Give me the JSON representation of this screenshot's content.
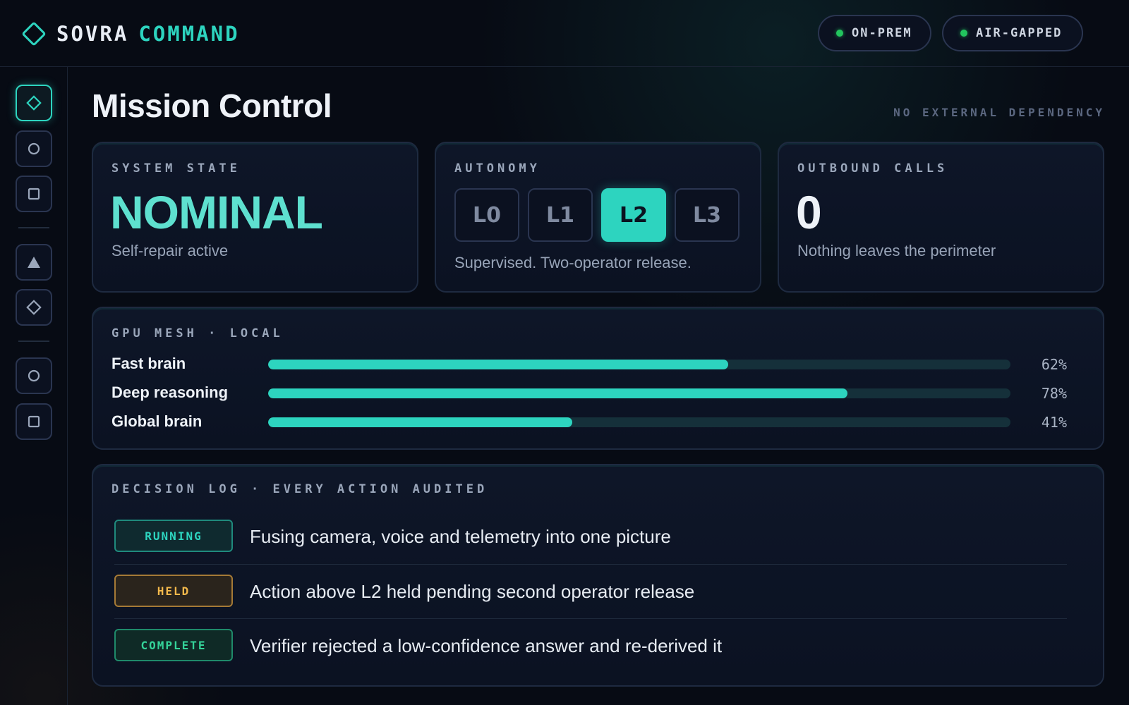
{
  "brand": {
    "name_part1": "SOVRA",
    "name_part2": "COMMAND"
  },
  "header": {
    "status_pills": [
      {
        "label": "ON-PREM"
      },
      {
        "label": "AIR-GAPPED"
      }
    ]
  },
  "sidebar": {
    "items": [
      {
        "icon": "diamond-icon",
        "active": true
      },
      {
        "icon": "circle-icon"
      },
      {
        "icon": "square-icon"
      },
      {
        "icon": "triangle-icon"
      },
      {
        "icon": "diamond-icon"
      },
      {
        "icon": "circle-icon"
      },
      {
        "icon": "square-icon"
      }
    ]
  },
  "page": {
    "title": "Mission Control",
    "tagline": "NO EXTERNAL DEPENDENCY"
  },
  "system_state": {
    "label": "SYSTEM STATE",
    "value": "NOMINAL",
    "sub": "Self-repair active"
  },
  "autonomy": {
    "label": "AUTONOMY",
    "levels": [
      "L0",
      "L1",
      "L2",
      "L3"
    ],
    "selected": "L2",
    "sub": "Supervised. Two-operator release."
  },
  "outbound": {
    "label": "OUTBOUND CALLS",
    "value": "0",
    "sub": "Nothing leaves the perimeter"
  },
  "gpu_mesh": {
    "label": "GPU MESH  ·  LOCAL",
    "rows": [
      {
        "name": "Fast brain",
        "percent": 62,
        "display": "62%"
      },
      {
        "name": "Deep reasoning",
        "percent": 78,
        "display": "78%"
      },
      {
        "name": "Global brain",
        "percent": 41,
        "display": "41%"
      }
    ]
  },
  "decision_log": {
    "label": "DECISION LOG  ·  EVERY ACTION AUDITED",
    "entries": [
      {
        "status": "RUNNING",
        "text": "Fusing camera, voice and telemetry into one picture"
      },
      {
        "status": "HELD",
        "text": "Action above L2 held pending second operator release"
      },
      {
        "status": "COMPLETE",
        "text": "Verifier rejected a low-confidence answer and re-derived it"
      }
    ]
  },
  "colors": {
    "accent": "#2dd4bf",
    "background": "#070b14",
    "status_running": "#2dd4bf",
    "status_held": "#f2b84b",
    "status_complete": "#34d399",
    "online_dot": "#22c55e"
  }
}
